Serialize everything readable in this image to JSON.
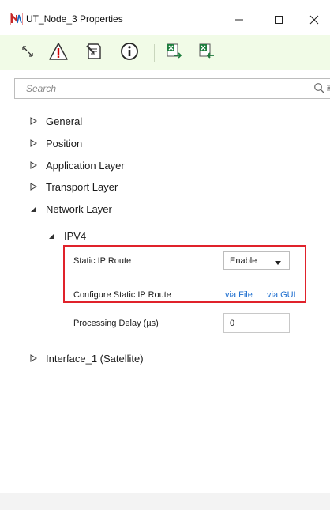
{
  "window": {
    "title": "UT_Node_3 Properties",
    "controls": {
      "minimize": "minimize-icon",
      "maximize": "maximize-icon",
      "close": "close-icon"
    }
  },
  "toolbar": {
    "background": "#f1fbe7",
    "buttons": [
      "expand-collapse-icon",
      "warning-icon",
      "notes-icon",
      "info-icon",
      "excel-export-icon",
      "excel-import-icon"
    ]
  },
  "search": {
    "placeholder": "Search",
    "value": ""
  },
  "tree": {
    "sections": [
      "General",
      "Position",
      "Application Layer",
      "Transport Layer",
      "Network Layer"
    ],
    "network_layer": {
      "subsection": "IPV4",
      "static_ip_route": {
        "label": "Static IP Route",
        "value": "Enable"
      },
      "configure_static_ip_route": {
        "label": "Configure Static IP Route",
        "via_file": "via File",
        "via_gui": "via GUI"
      },
      "processing_delay": {
        "label": "Processing Delay (µs)",
        "value": "0"
      }
    },
    "interface": "Interface_1 (Satellite)"
  },
  "colors": {
    "highlight_border": "#e0222b",
    "link": "#1f6fcf"
  }
}
